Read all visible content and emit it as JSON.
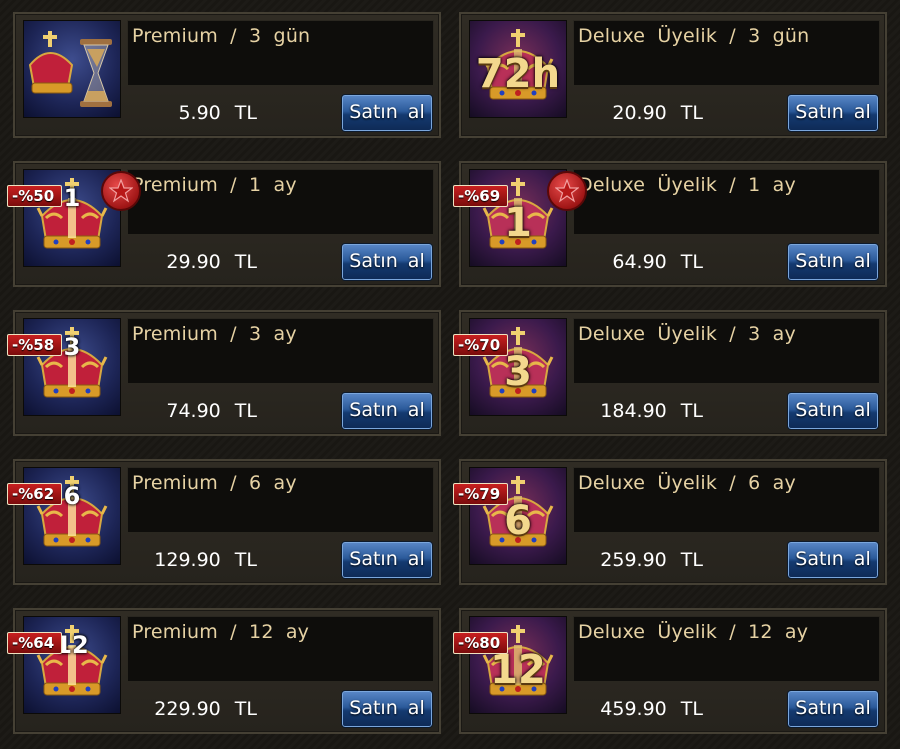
{
  "cards": [
    {
      "id": "premium-3-gun",
      "type": "premium",
      "title": "Premium / 3 gün",
      "price": "5.90 TL",
      "button": "Satın al",
      "discount": null,
      "icon": "crown-hourglass-icon",
      "number": ""
    },
    {
      "id": "deluxe-3-gun",
      "type": "deluxe",
      "title": "Deluxe Üyelik / 3 gün",
      "price": "20.90 TL",
      "button": "Satın al",
      "discount": null,
      "icon": "crown-72h-icon",
      "number": "72h"
    },
    {
      "id": "premium-1-ay",
      "type": "premium",
      "title": "Premium / 1 ay",
      "price": "29.90 TL",
      "button": "Satın al",
      "discount": "-%50",
      "star": true,
      "icon": "crown-icon",
      "number": "1"
    },
    {
      "id": "deluxe-1-ay",
      "type": "deluxe",
      "title": "Deluxe Üyelik / 1 ay",
      "price": "64.90 TL",
      "button": "Satın al",
      "discount": "-%69",
      "star": true,
      "icon": "crown-icon",
      "number": "1"
    },
    {
      "id": "premium-3-ay",
      "type": "premium",
      "title": "Premium / 3 ay",
      "price": "74.90 TL",
      "button": "Satın al",
      "discount": "-%58",
      "icon": "crown-icon",
      "number": "3"
    },
    {
      "id": "deluxe-3-ay",
      "type": "deluxe",
      "title": "Deluxe Üyelik / 3 ay",
      "price": "184.90 TL",
      "button": "Satın al",
      "discount": "-%70",
      "icon": "crown-icon",
      "number": "3"
    },
    {
      "id": "premium-6-ay",
      "type": "premium",
      "title": "Premium / 6 ay",
      "price": "129.90 TL",
      "button": "Satın al",
      "discount": "-%62",
      "icon": "crown-icon",
      "number": "6"
    },
    {
      "id": "deluxe-6-ay",
      "type": "deluxe",
      "title": "Deluxe Üyelik / 6 ay",
      "price": "259.90 TL",
      "button": "Satın al",
      "discount": "-%79",
      "icon": "crown-icon",
      "number": "6"
    },
    {
      "id": "premium-12-ay",
      "type": "premium",
      "title": "Premium / 12 ay",
      "price": "229.90 TL",
      "button": "Satın al",
      "discount": "-%64",
      "icon": "crown-icon",
      "number": "12"
    },
    {
      "id": "deluxe-12-ay",
      "type": "deluxe",
      "title": "Deluxe Üyelik / 12 ay",
      "price": "459.90 TL",
      "button": "Satın al",
      "discount": "-%80",
      "icon": "crown-icon",
      "number": "12"
    }
  ]
}
